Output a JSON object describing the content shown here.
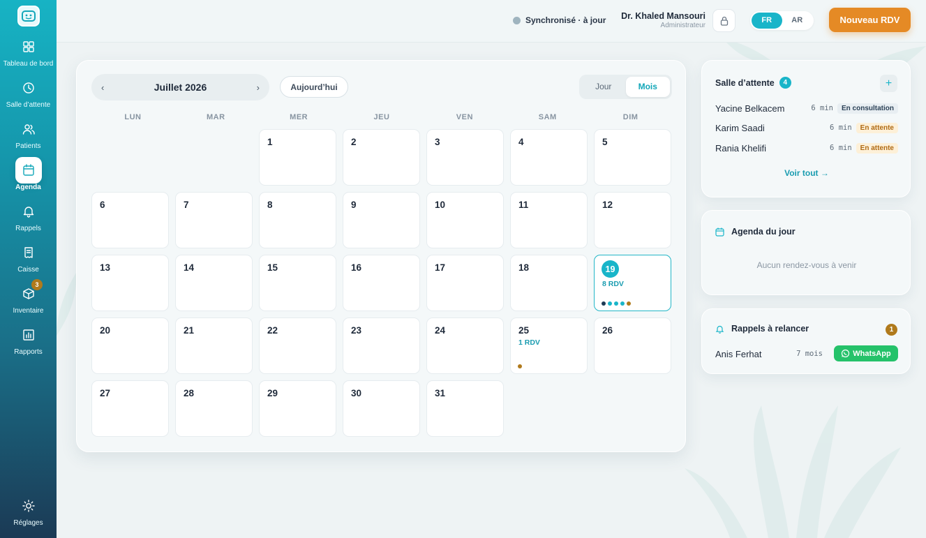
{
  "sidebar": {
    "items": [
      {
        "label": "Tableau de bord",
        "icon": "grid-icon"
      },
      {
        "label": "Salle d’attente",
        "icon": "clock-icon"
      },
      {
        "label": "Patients",
        "icon": "users-icon"
      },
      {
        "label": "Agenda",
        "icon": "calendar-icon",
        "active": true
      },
      {
        "label": "Rappels",
        "icon": "bell-icon"
      },
      {
        "label": "Caisse",
        "icon": "receipt-icon"
      },
      {
        "label": "Inventaire",
        "icon": "box-icon",
        "badge": "3"
      },
      {
        "label": "Rapports",
        "icon": "chart-icon"
      }
    ],
    "settings_label": "Réglages"
  },
  "topbar": {
    "sync_text": "Synchronisé · à jour",
    "user_name": "Dr. Khaled Mansouri",
    "user_role": "Administrateur",
    "lang_fr": "FR",
    "lang_ar": "AR",
    "new_rdv": "Nouveau RDV"
  },
  "calendar": {
    "month_title": "Juillet 2026",
    "prev": "‹",
    "next": "›",
    "today_label": "Aujourd’hui",
    "view_day": "Jour",
    "view_month": "Mois",
    "weekdays": [
      "LUN",
      "MAR",
      "MER",
      "JEU",
      "VEN",
      "SAM",
      "DIM"
    ],
    "first_weekday_index": 2,
    "days_in_month": 31,
    "today": 19,
    "events": {
      "19": {
        "label": "8 RDV",
        "dots": [
          "#1e3a55",
          "#19b5c9",
          "#19b5c9",
          "#19b5c9",
          "#b07a1c"
        ]
      },
      "25": {
        "label": "1 RDV",
        "dots": [
          "#b07a1c"
        ]
      }
    }
  },
  "waiting_room": {
    "title": "Salle d’attente",
    "count": "4",
    "add": "+",
    "rows": [
      {
        "name": "Yacine Belkacem",
        "time": "6 min",
        "status": "En consultation",
        "kind": "consult"
      },
      {
        "name": "Karim Saadi",
        "time": "6 min",
        "status": "En attente",
        "kind": "waiting"
      },
      {
        "name": "Rania Khelifi",
        "time": "6 min",
        "status": "En attente",
        "kind": "waiting"
      }
    ],
    "see_all": "Voir tout →"
  },
  "agenda_day": {
    "title": "Agenda du jour",
    "empty": "Aucun rendez-vous à venir"
  },
  "reminders": {
    "title": "Rappels à relancer",
    "count": "1",
    "name": "Anis Ferhat",
    "delay": "7 mois",
    "whatsapp": "WhatsApp"
  },
  "colors": {
    "accent": "#19b5c9",
    "orange": "#e58a25",
    "amber": "#b07a1c",
    "whatsapp": "#25c26a"
  }
}
